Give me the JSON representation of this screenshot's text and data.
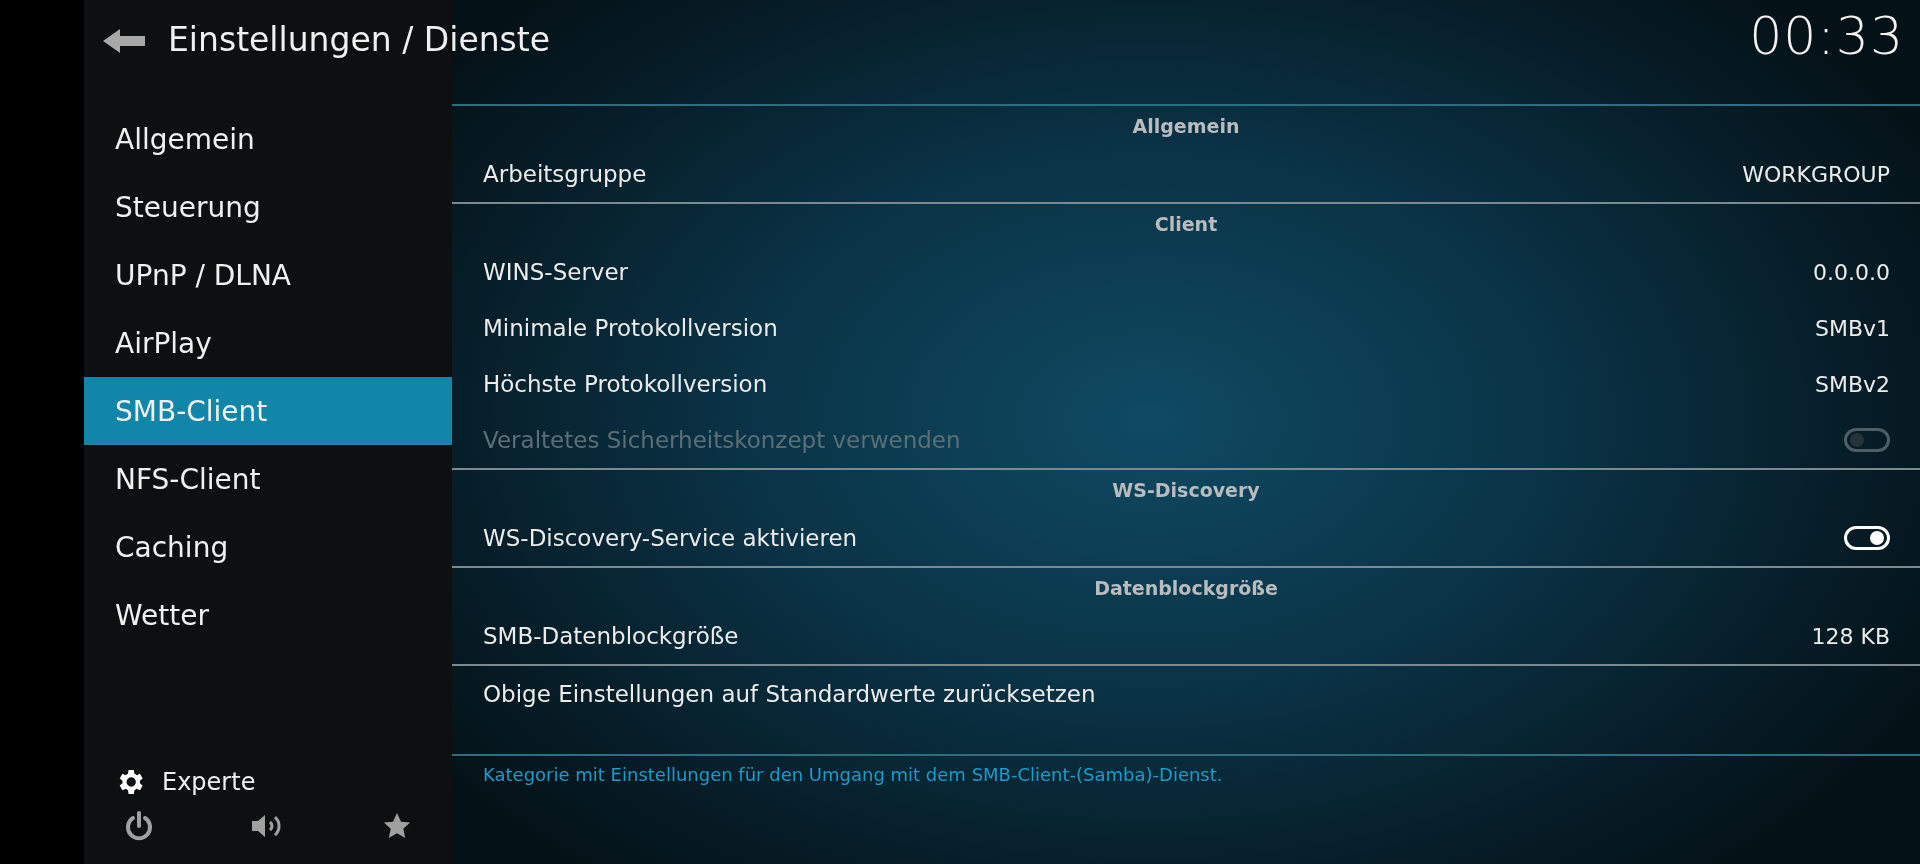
{
  "header": {
    "title": "Einstellungen / Dienste",
    "clock": "00:33"
  },
  "sidebar": {
    "items": [
      {
        "label": "Allgemein",
        "selected": false
      },
      {
        "label": "Steuerung",
        "selected": false
      },
      {
        "label": "UPnP / DLNA",
        "selected": false
      },
      {
        "label": "AirPlay",
        "selected": false
      },
      {
        "label": "SMB-Client",
        "selected": true
      },
      {
        "label": "NFS-Client",
        "selected": false
      },
      {
        "label": "Caching",
        "selected": false
      },
      {
        "label": "Wetter",
        "selected": false
      }
    ],
    "level": {
      "label": "Experte"
    }
  },
  "settings": [
    {
      "kind": "section",
      "label": "Allgemein"
    },
    {
      "kind": "value",
      "label": "Arbeitsgruppe",
      "value": "WORKGROUP",
      "disabled": false
    },
    {
      "kind": "section",
      "label": "Client"
    },
    {
      "kind": "value",
      "label": "WINS-Server",
      "value": "0.0.0.0",
      "disabled": false
    },
    {
      "kind": "value",
      "label": "Minimale Protokollversion",
      "value": "SMBv1",
      "disabled": false
    },
    {
      "kind": "value",
      "label": "Höchste Protokollversion",
      "value": "SMBv2",
      "disabled": false
    },
    {
      "kind": "toggle",
      "label": "Veraltetes Sicherheitskonzept verwenden",
      "on": false,
      "disabled": true
    },
    {
      "kind": "section",
      "label": "WS-Discovery"
    },
    {
      "kind": "toggle",
      "label": "WS-Discovery-Service aktivieren",
      "on": true,
      "disabled": false
    },
    {
      "kind": "section",
      "label": "Datenblockgröße"
    },
    {
      "kind": "value",
      "label": "SMB-Datenblockgröße",
      "value": "128 KB",
      "disabled": false
    },
    {
      "kind": "action",
      "label": "Obige Einstellungen auf Standardwerte zurücksetzen",
      "disabled": false
    }
  ],
  "description": "Kategorie mit Einstellungen für den Umgang mit dem SMB-Client-(Samba)-Dienst."
}
